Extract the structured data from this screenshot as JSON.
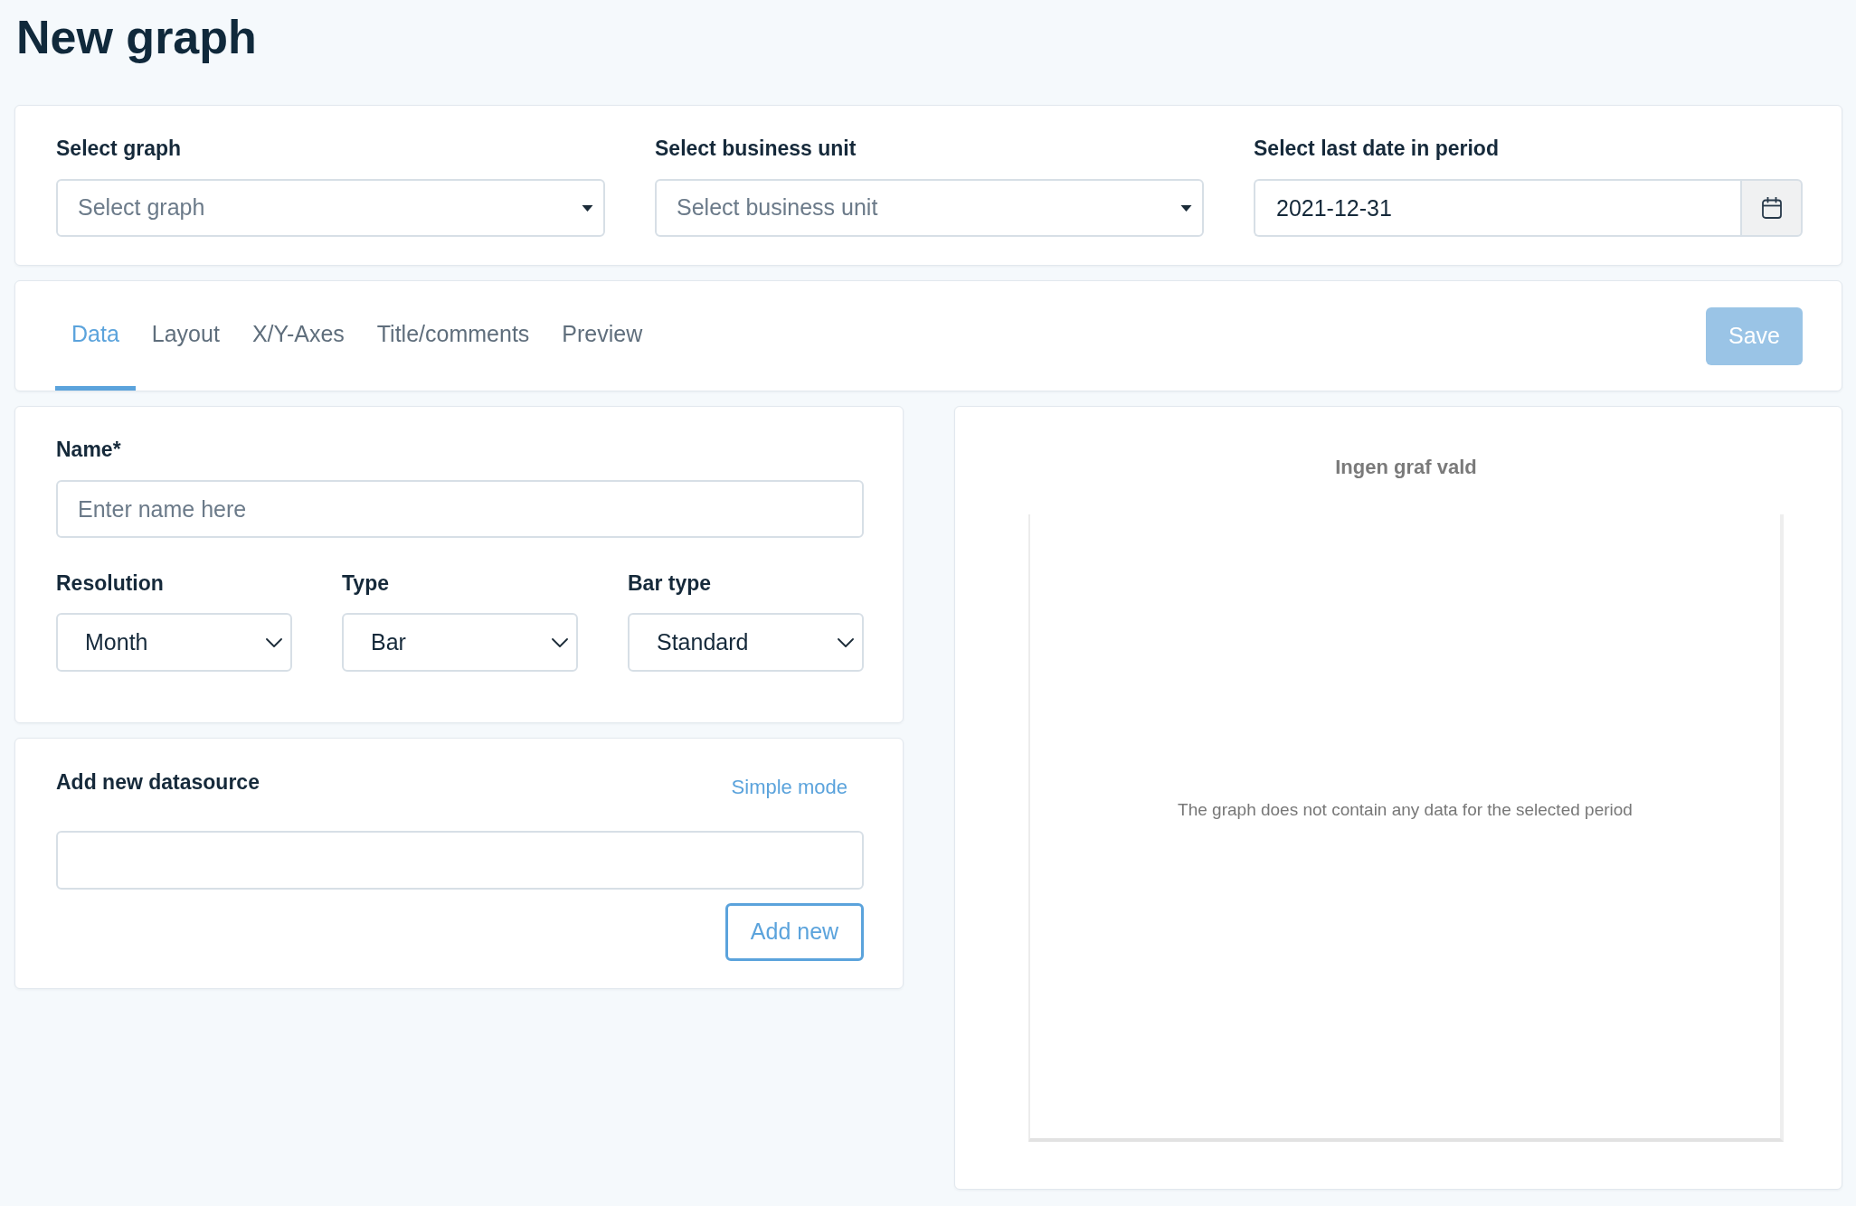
{
  "page": {
    "title": "New graph"
  },
  "filters": [
    {
      "kind": "select",
      "label": "Select graph",
      "placeholder": "Select graph"
    },
    {
      "kind": "select",
      "label": "Select business unit",
      "placeholder": "Select business unit"
    },
    {
      "kind": "date",
      "label": "Select last date in period",
      "value": "2021-12-31"
    }
  ],
  "tabs": [
    {
      "label": "Data",
      "selected": true
    },
    {
      "label": "Layout",
      "selected": false
    },
    {
      "label": "X/Y-Axes",
      "selected": false
    },
    {
      "label": "Title/comments",
      "selected": false
    },
    {
      "label": "Preview",
      "selected": false
    }
  ],
  "save_button": {
    "label": "Save",
    "disabled": true
  },
  "graph_settings": {
    "name_field": {
      "label": "Name*",
      "placeholder": "Enter name here"
    },
    "selects": [
      {
        "label": "Resolution",
        "value": "Month"
      },
      {
        "label": "Type",
        "value": "Bar"
      },
      {
        "label": "Bar type",
        "value": "Standard"
      }
    ]
  },
  "datasource": {
    "title": "Add new datasource",
    "mode_link": "Simple mode",
    "add_button": "Add new"
  },
  "preview": {
    "title": "Ingen graf vald",
    "message": "The graph does not contain any data for the selected period"
  }
}
